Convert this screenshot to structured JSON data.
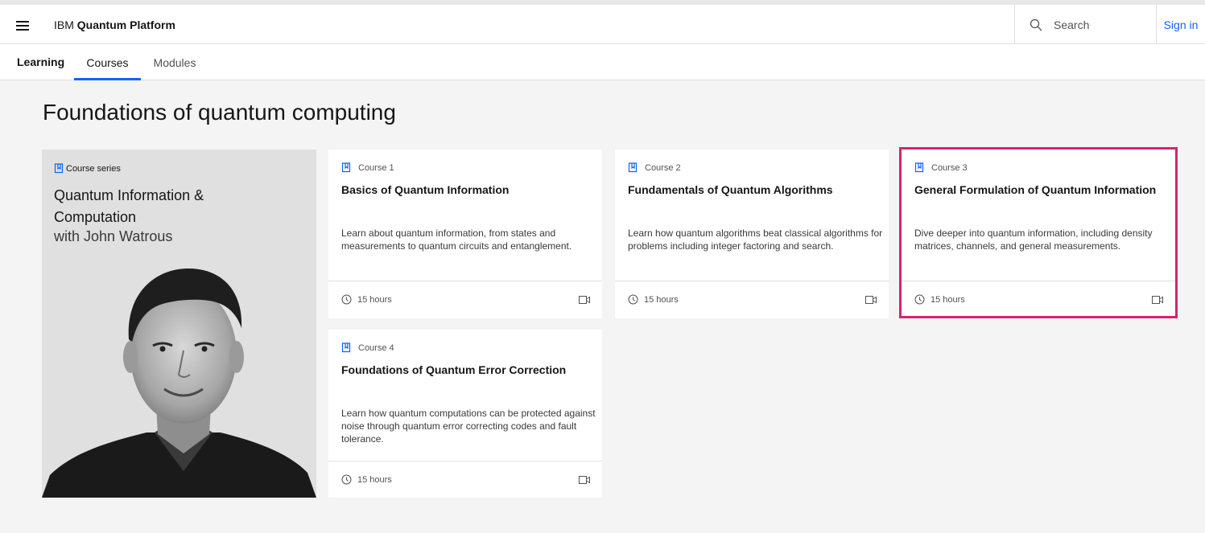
{
  "header": {
    "brand_prefix": "IBM",
    "brand_name": "Quantum Platform",
    "search_placeholder": "Search",
    "signin_label": "Sign in"
  },
  "subnav": {
    "section": "Learning",
    "tabs": [
      {
        "label": "Courses",
        "active": true
      },
      {
        "label": "Modules",
        "active": false
      }
    ]
  },
  "page": {
    "title": "Foundations of quantum computing"
  },
  "series": {
    "eyebrow": "Course series",
    "title": "Quantum Information & Computation",
    "subtitle": "with John Watrous"
  },
  "courses": [
    {
      "eyebrow": "Course 1",
      "title": "Basics of Quantum Information",
      "description": "Learn about quantum information, from states and measurements to quantum circuits and entanglement.",
      "duration": "15 hours"
    },
    {
      "eyebrow": "Course 2",
      "title": "Fundamentals of Quantum Algorithms",
      "description": "Learn how quantum algorithms beat classical algorithms for problems including integer factoring and search.",
      "duration": "15 hours"
    },
    {
      "eyebrow": "Course 3",
      "title": "General Formulation of Quantum Information",
      "description": "Dive deeper into quantum information, including density matrices, channels, and general measurements.",
      "duration": "15 hours"
    },
    {
      "eyebrow": "Course 4",
      "title": "Foundations of Quantum Error Correction",
      "description": "Learn how quantum computations can be protected against noise through quantum error correcting codes and fault tolerance.",
      "duration": "15 hours"
    }
  ],
  "colors": {
    "accent": "#0f62fe",
    "highlight": "#d02670",
    "background": "#f4f4f4"
  },
  "icons": [
    "menu-icon",
    "search-icon",
    "book-icon",
    "clock-icon",
    "video-icon"
  ]
}
